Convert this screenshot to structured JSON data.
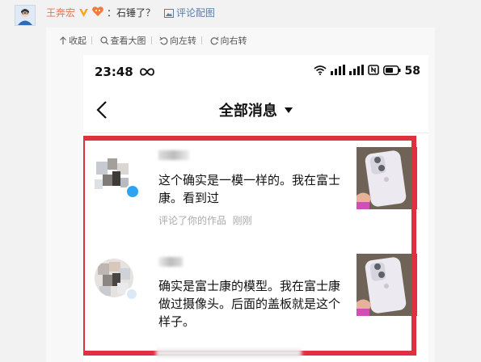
{
  "comment": {
    "user_name": "王奔宏",
    "text": "：石锤了？",
    "reply_pic_label": "评论配图"
  },
  "toolbar": {
    "collapse": "收起",
    "view_large": "查看大图",
    "rotate_left": "向左转",
    "rotate_right": "向右转"
  },
  "screenshot": {
    "status_time": "23:48",
    "battery": "58",
    "title": "全部消息",
    "messages": [
      {
        "name": "",
        "text": "这个确实是一模一样的。我在富士康。看到过",
        "meta_action": "评论了你的作品",
        "meta_time": "刚刚"
      },
      {
        "name": "",
        "text": "确实是富士康的模型。我在富士康做过摄像头。后面的盖板就是这个样子。"
      }
    ]
  },
  "colors": {
    "highlight_border": "#e02f3e",
    "username": "#eb7350",
    "link": "#5b7ea8"
  }
}
